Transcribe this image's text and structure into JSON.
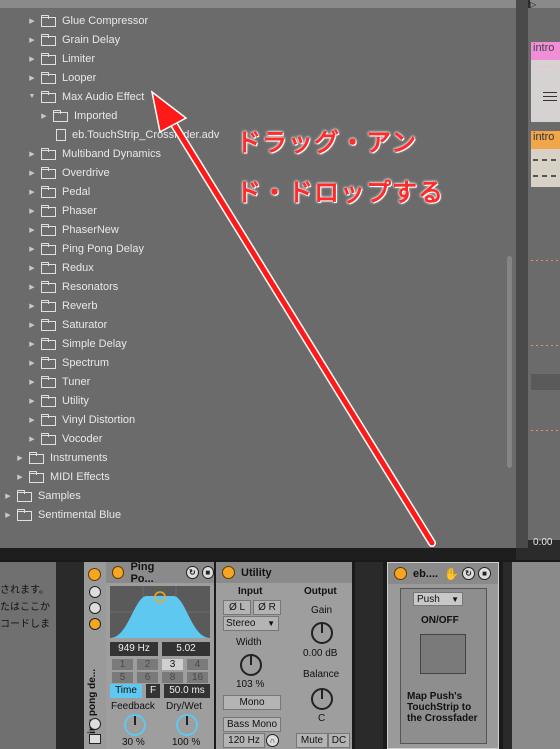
{
  "browser": {
    "items": [
      {
        "label": "Glue Compressor",
        "depth": 2,
        "type": "folder",
        "arrow": "▶"
      },
      {
        "label": "Grain Delay",
        "depth": 2,
        "type": "folder",
        "arrow": "▶"
      },
      {
        "label": "Limiter",
        "depth": 2,
        "type": "folder",
        "arrow": "▶"
      },
      {
        "label": "Looper",
        "depth": 2,
        "type": "folder",
        "arrow": "▶"
      },
      {
        "label": "Max Audio Effect",
        "depth": 2,
        "type": "folder",
        "arrow": "▼"
      },
      {
        "label": "Imported",
        "depth": 3,
        "type": "folder",
        "arrow": "▶"
      },
      {
        "label": "eb.TouchStrip_Crossfader.adv",
        "depth": 3,
        "type": "file",
        "arrow": ""
      },
      {
        "label": "Multiband Dynamics",
        "depth": 2,
        "type": "folder",
        "arrow": "▶"
      },
      {
        "label": "Overdrive",
        "depth": 2,
        "type": "folder",
        "arrow": "▶"
      },
      {
        "label": "Pedal",
        "depth": 2,
        "type": "folder",
        "arrow": "▶"
      },
      {
        "label": "Phaser",
        "depth": 2,
        "type": "folder",
        "arrow": "▶"
      },
      {
        "label": "PhaserNew",
        "depth": 2,
        "type": "folder",
        "arrow": "▶"
      },
      {
        "label": "Ping Pong Delay",
        "depth": 2,
        "type": "folder",
        "arrow": "▶"
      },
      {
        "label": "Redux",
        "depth": 2,
        "type": "folder",
        "arrow": "▶"
      },
      {
        "label": "Resonators",
        "depth": 2,
        "type": "folder",
        "arrow": "▶"
      },
      {
        "label": "Reverb",
        "depth": 2,
        "type": "folder",
        "arrow": "▶"
      },
      {
        "label": "Saturator",
        "depth": 2,
        "type": "folder",
        "arrow": "▶"
      },
      {
        "label": "Simple Delay",
        "depth": 2,
        "type": "folder",
        "arrow": "▶"
      },
      {
        "label": "Spectrum",
        "depth": 2,
        "type": "folder",
        "arrow": "▶"
      },
      {
        "label": "Tuner",
        "depth": 2,
        "type": "folder",
        "arrow": "▶"
      },
      {
        "label": "Utility",
        "depth": 2,
        "type": "folder",
        "arrow": "▶"
      },
      {
        "label": "Vinyl Distortion",
        "depth": 2,
        "type": "folder",
        "arrow": "▶"
      },
      {
        "label": "Vocoder",
        "depth": 2,
        "type": "folder",
        "arrow": "▶"
      },
      {
        "label": "Instruments",
        "depth": 1,
        "type": "folder",
        "arrow": "▶"
      },
      {
        "label": "MIDI Effects",
        "depth": 1,
        "type": "folder",
        "arrow": "▶"
      },
      {
        "label": "Samples",
        "depth": 0,
        "type": "folder",
        "arrow": "▶"
      },
      {
        "label": "Sentimental Blue",
        "depth": 0,
        "type": "folder",
        "arrow": "▶"
      }
    ]
  },
  "arrangement": {
    "clip1": "intro",
    "clip2": "intro",
    "time": "0:00"
  },
  "overlay": {
    "line1": "ドラッグ・アン",
    "line2": "ド・ドロップする",
    "arrow_color": "#ff1a1a"
  },
  "info": {
    "lines": [
      "されます。",
      "たはここか",
      "コードしま"
    ]
  },
  "chain": {
    "name": "ping pong de..."
  },
  "pingpong": {
    "title": "Ping Po...",
    "freq": "949 Hz",
    "width": "5.02",
    "beats": [
      "1",
      "2",
      "3",
      "4",
      "5",
      "6",
      "8",
      "16"
    ],
    "time_label": "Time",
    "f_label": "F",
    "time_ms": "50.0 ms",
    "feedback_label": "Feedback",
    "drywet_label": "Dry/Wet",
    "feedback_value": "30 %",
    "drywet_value": "100 %"
  },
  "utility": {
    "title": "Utility",
    "input_label": "Input",
    "phase_l": "Ø L",
    "phase_r": "Ø R",
    "channel_mode": "Stereo",
    "width_label": "Width",
    "width_value": "103 %",
    "mono": "Mono",
    "bass_mono": "Bass Mono",
    "bass_freq": "120 Hz",
    "output_label": "Output",
    "gain_label": "Gain",
    "gain_value": "0.00 dB",
    "balance_label": "Balance",
    "balance_value": "C",
    "mute": "Mute",
    "dc": "DC"
  },
  "touchstrip": {
    "title": "eb....",
    "mode": "Push",
    "onoff": "ON/OFF",
    "description": "Map Push's TouchStrip to the Crossfader"
  },
  "colors": {
    "accent": "#f6a623",
    "browser_bg": "#6b6b6b",
    "clip_orange": "#f0a64a",
    "clip_pink": "#f08ed8",
    "highlight_blue": "#5ec8f0"
  }
}
